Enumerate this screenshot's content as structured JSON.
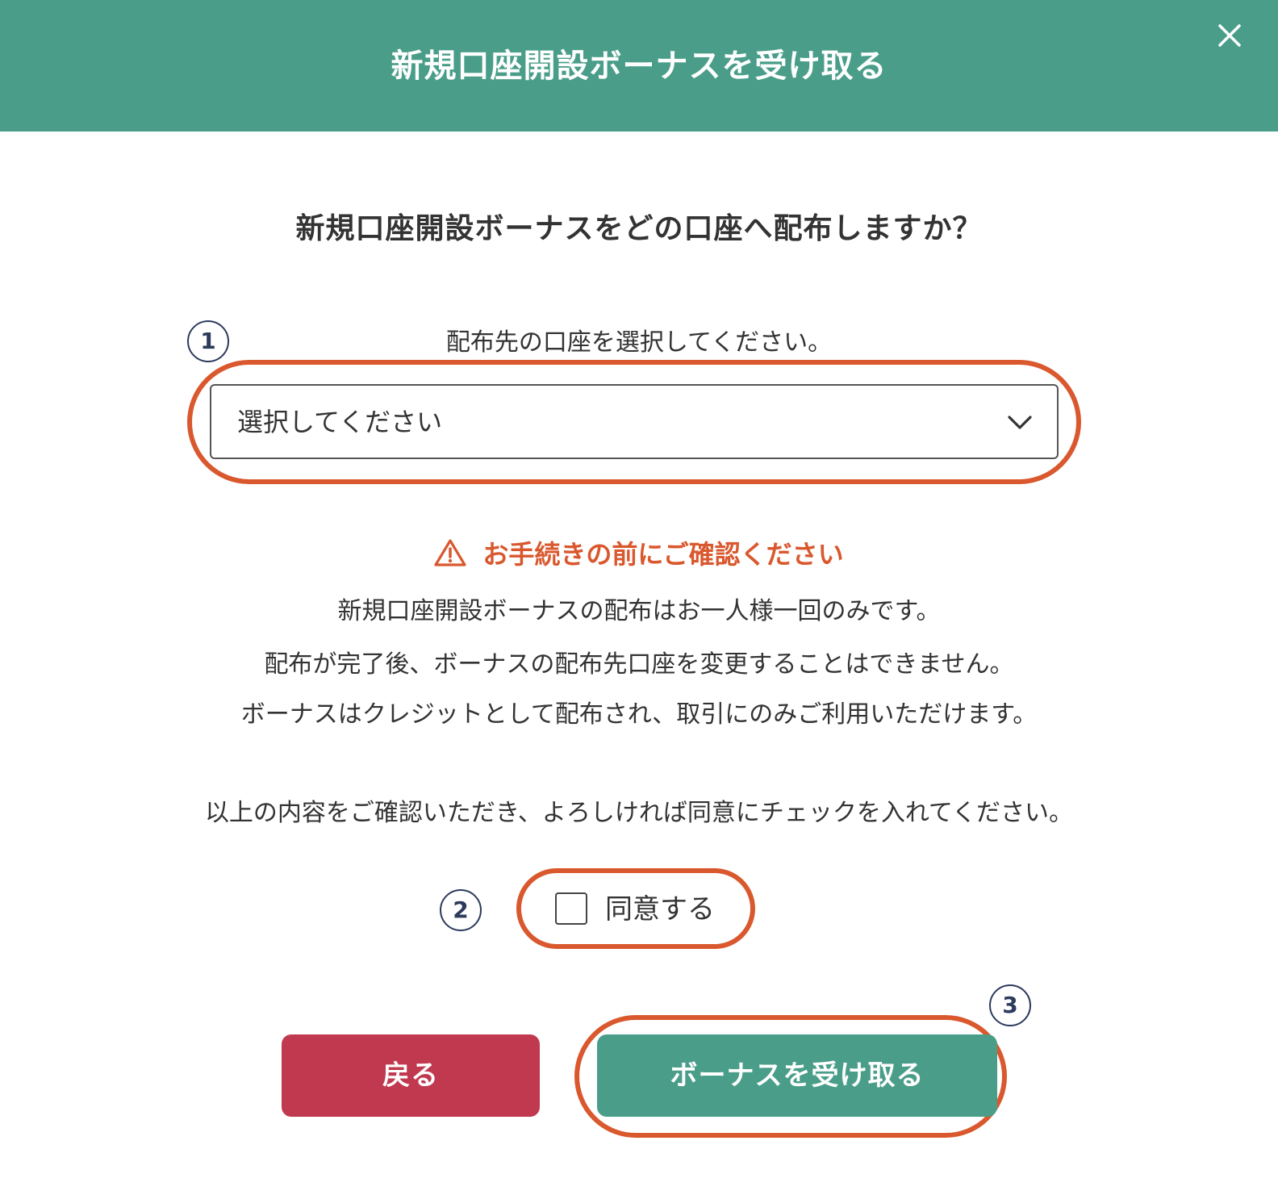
{
  "header": {
    "title": "新規口座開設ボーナスを受け取る",
    "close_icon": "close-icon"
  },
  "question": "新規口座開設ボーナスをどの口座へ配布しますか？",
  "steps": {
    "step1": "1",
    "step2": "2",
    "step3": "3"
  },
  "account_select": {
    "label": "配布先の口座を選択してください。",
    "value": "選択してください",
    "icon": "chevron-down-icon"
  },
  "warning": {
    "title": "お手続きの前にご確認ください",
    "icon": "warning-icon",
    "lines": [
      "新規口座開設ボーナスの配布はお一人様一回のみです。",
      "配布が完了後、ボーナスの配布先口座を変更することはできません。",
      "ボーナスはクレジットとして配布され、取引にのみご利用いただけます。"
    ]
  },
  "agreement": {
    "instruction": "以上の内容をご確認いただき、よろしければ同意にチェックを入れてください。",
    "checkbox_label": "同意する",
    "checked": false
  },
  "buttons": {
    "back": "戻る",
    "receive": "ボーナスを受け取る"
  },
  "colors": {
    "header_bg": "#4a9e89",
    "accent_orange": "#d9582e",
    "back_button": "#c0394f",
    "receive_button": "#4a9e89",
    "badge": "#2c3a5c"
  }
}
